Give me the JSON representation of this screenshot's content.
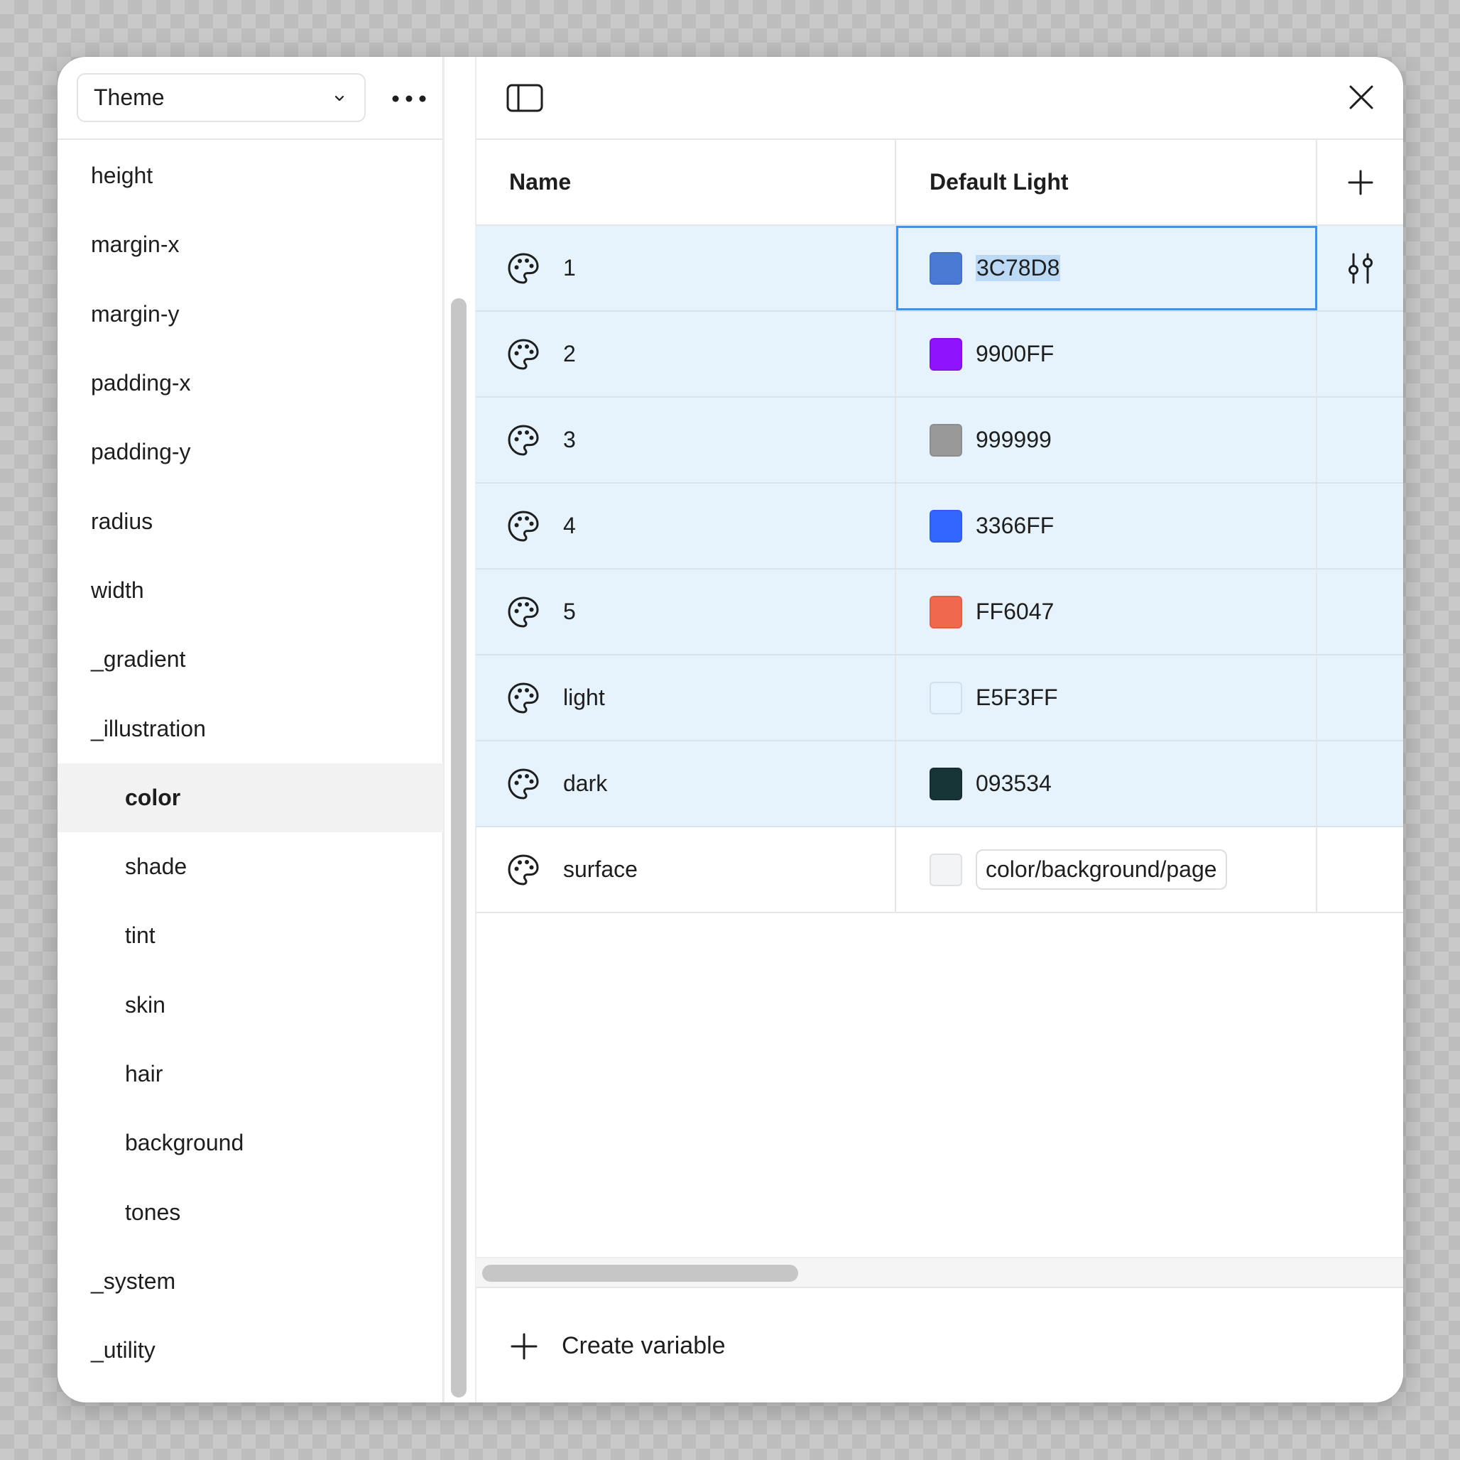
{
  "sidebar": {
    "collection_select": "Theme",
    "items": [
      {
        "label": "height",
        "level": 0,
        "active": false
      },
      {
        "label": "margin-x",
        "level": 0,
        "active": false
      },
      {
        "label": "margin-y",
        "level": 0,
        "active": false
      },
      {
        "label": "padding-x",
        "level": 0,
        "active": false
      },
      {
        "label": "padding-y",
        "level": 0,
        "active": false
      },
      {
        "label": "radius",
        "level": 0,
        "active": false
      },
      {
        "label": "width",
        "level": 0,
        "active": false
      },
      {
        "label": "_gradient",
        "level": 0,
        "active": false
      },
      {
        "label": "_illustration",
        "level": 0,
        "active": false
      },
      {
        "label": "color",
        "level": 1,
        "active": true
      },
      {
        "label": "shade",
        "level": 1,
        "active": false
      },
      {
        "label": "tint",
        "level": 1,
        "active": false
      },
      {
        "label": "skin",
        "level": 1,
        "active": false
      },
      {
        "label": "hair",
        "level": 1,
        "active": false
      },
      {
        "label": "background",
        "level": 1,
        "active": false
      },
      {
        "label": "tones",
        "level": 1,
        "active": false
      },
      {
        "label": "_system",
        "level": 0,
        "active": false
      },
      {
        "label": "_utility",
        "level": 0,
        "active": false
      }
    ]
  },
  "table": {
    "columns": {
      "name": "Name",
      "mode": "Default Light"
    },
    "rows": [
      {
        "name": "1",
        "value": "3C78D8",
        "color": "#4A7BD4",
        "selected": true,
        "focused": true
      },
      {
        "name": "2",
        "value": "9900FF",
        "color": "#9013FE",
        "selected": true,
        "focused": false
      },
      {
        "name": "3",
        "value": "999999",
        "color": "#999999",
        "selected": true,
        "focused": false
      },
      {
        "name": "4",
        "value": "3366FF",
        "color": "#3366FF",
        "selected": true,
        "focused": false
      },
      {
        "name": "5",
        "value": "FF6047",
        "color": "#F0694F",
        "selected": true,
        "focused": false
      },
      {
        "name": "light",
        "value": "E5F3FF",
        "color": "#E5F3FF",
        "selected": true,
        "focused": false
      },
      {
        "name": "dark",
        "value": "093534",
        "color": "#173436",
        "selected": true,
        "focused": false
      },
      {
        "name": "surface",
        "value": "color/background/page",
        "color": "#F3F4F6",
        "selected": false,
        "focused": false,
        "alias": true
      }
    ]
  },
  "footer": {
    "create_label": "Create variable"
  },
  "colors": {
    "selection": "#E6F2FC",
    "focus": "#4A8EE0"
  }
}
